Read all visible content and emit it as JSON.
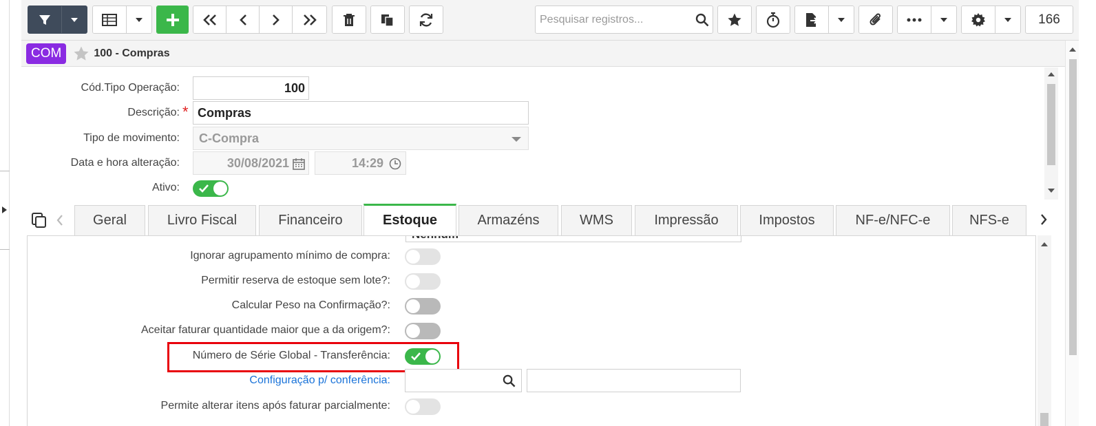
{
  "toolbar": {
    "search_placeholder": "Pesquisar registros...",
    "record_count": "166"
  },
  "header": {
    "module_badge": "COM",
    "title": "100 - Compras"
  },
  "form": {
    "cod_tipo_operacao": {
      "label": "Cód.Tipo Operação:",
      "value": "100"
    },
    "descricao": {
      "label": "Descrição:",
      "value": "Compras",
      "required_mark": "*"
    },
    "tipo_movimento": {
      "label": "Tipo de movimento:",
      "value": "C-Compra"
    },
    "data_hora_alteracao": {
      "label": "Data e hora alteração:",
      "date": "30/08/2021",
      "time": "14:29"
    },
    "ativo": {
      "label": "Ativo:",
      "on": true
    }
  },
  "tabs": [
    {
      "label": "Geral"
    },
    {
      "label": "Livro Fiscal"
    },
    {
      "label": "Financeiro"
    },
    {
      "label": "Estoque",
      "active": true
    },
    {
      "label": "Armazéns"
    },
    {
      "label": "WMS"
    },
    {
      "label": "Impressão"
    },
    {
      "label": "Impostos"
    },
    {
      "label": "NF-e/NFC-e"
    },
    {
      "label": "NFS-e"
    }
  ],
  "estoque": {
    "cut_value": "Nenhum",
    "fields": [
      {
        "label": "Ignorar agrupamento mínimo de compra:",
        "state": "disabled-off"
      },
      {
        "label": "Permitir reserva de estoque sem lote?:",
        "state": "disabled-off"
      },
      {
        "label": "Calcular Peso na Confirmação?:",
        "state": "off"
      },
      {
        "label": "Aceitar faturar quantidade maior que a da origem?:",
        "state": "off"
      },
      {
        "label": "Número de Série Global - Transferência:",
        "state": "on"
      },
      {
        "label": "Configuração p/ conferência:",
        "state": "lookup"
      },
      {
        "label": "Permite alterar itens após faturar parcialmente:",
        "state": "disabled-off"
      }
    ]
  },
  "colors": {
    "accent_green": "#3bb74a",
    "module_purple": "#8a2be2",
    "highlight_red": "#e8000b",
    "toolbar_dark": "#3f4b5b",
    "link_blue": "#1a73d9"
  }
}
